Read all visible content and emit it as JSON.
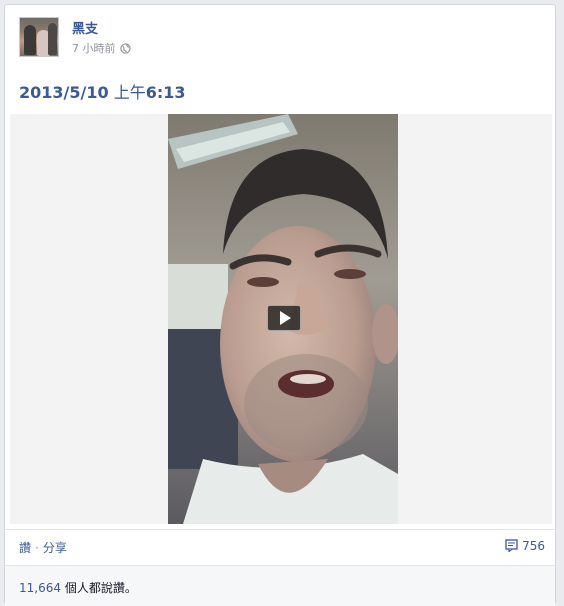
{
  "post": {
    "author": "黑支",
    "timestamp": "7 小時前",
    "privacy_icon": "globe-icon",
    "title": {
      "date": "2013/5/10",
      "ampm": "上午",
      "time": "6:13"
    },
    "video": {
      "play_icon": "play-icon"
    },
    "actions": {
      "like": "讚",
      "separator": "·",
      "share": "分享"
    },
    "comments": {
      "icon": "comment-icon",
      "count": "756"
    },
    "likes": {
      "count": "11,664",
      "text": " 個人都說讚。"
    }
  },
  "colors": {
    "link": "#3b5998",
    "meta": "#90949c",
    "likes_bar_bg": "#f6f7f9"
  }
}
